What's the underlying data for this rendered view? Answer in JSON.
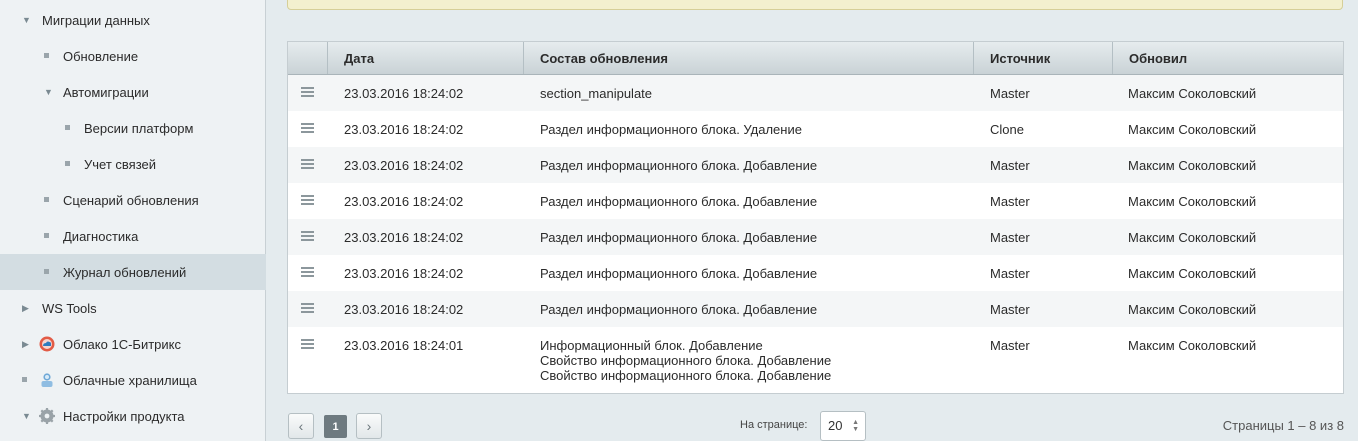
{
  "sidebar": {
    "items": [
      {
        "label": "Миграции данных",
        "expand": "down",
        "marker": "none"
      },
      {
        "label": "Обновление",
        "expand": "none",
        "marker": "bullet"
      },
      {
        "label": "Автомиграции",
        "expand": "down",
        "marker": "none"
      },
      {
        "label": "Версии платформ",
        "expand": "none",
        "marker": "bullet"
      },
      {
        "label": "Учет связей",
        "expand": "none",
        "marker": "bullet"
      },
      {
        "label": "Сценарий обновления",
        "expand": "none",
        "marker": "bullet"
      },
      {
        "label": "Диагностика",
        "expand": "none",
        "marker": "bullet"
      },
      {
        "label": "Журнал обновлений",
        "expand": "none",
        "marker": "bullet",
        "active": true
      },
      {
        "label": "WS Tools",
        "expand": "right",
        "marker": "none"
      },
      {
        "label": "Облако 1С-Битрикс",
        "expand": "right",
        "icon": "cloud-bitrix-icon"
      },
      {
        "label": "Облачные хранилища",
        "expand": "none",
        "marker": "bullet",
        "icon": "cloud-storage-icon"
      },
      {
        "label": "Настройки продукта",
        "expand": "down",
        "icon": "gear-icon"
      }
    ]
  },
  "table": {
    "headers": [
      "",
      "Дата",
      "Состав обновления",
      "Источник",
      "Обновил"
    ],
    "rows": [
      {
        "date": "23.03.2016 18:24:02",
        "content": [
          "section_manipulate"
        ],
        "source": "Master",
        "user": "Максим Соколовский"
      },
      {
        "date": "23.03.2016 18:24:02",
        "content": [
          "Раздел информационного блока. Удаление"
        ],
        "source": "Clone",
        "user": "Максим Соколовский"
      },
      {
        "date": "23.03.2016 18:24:02",
        "content": [
          "Раздел информационного блока. Добавление"
        ],
        "source": "Master",
        "user": "Максим Соколовский"
      },
      {
        "date": "23.03.2016 18:24:02",
        "content": [
          "Раздел информационного блока. Добавление"
        ],
        "source": "Master",
        "user": "Максим Соколовский"
      },
      {
        "date": "23.03.2016 18:24:02",
        "content": [
          "Раздел информационного блока. Добавление"
        ],
        "source": "Master",
        "user": "Максим Соколовский"
      },
      {
        "date": "23.03.2016 18:24:02",
        "content": [
          "Раздел информационного блока. Добавление"
        ],
        "source": "Master",
        "user": "Максим Соколовский"
      },
      {
        "date": "23.03.2016 18:24:02",
        "content": [
          "Раздел информационного блока. Добавление"
        ],
        "source": "Master",
        "user": "Максим Соколовский"
      },
      {
        "date": "23.03.2016 18:24:01",
        "content": [
          "Информационный блок. Добавление",
          "Свойство информационного блока. Добавление",
          "Свойство информационного блока. Добавление"
        ],
        "source": "Master",
        "user": "Максим Соколовский"
      }
    ]
  },
  "pagination": {
    "prev": "‹",
    "next": "›",
    "current_page": "1",
    "per_page_label": "На странице:",
    "per_page_value": "20",
    "summary": "Страницы 1 – 8 из 8"
  },
  "colors": {
    "active_item": "#d3dde2",
    "alt_row": "#f4f6f7",
    "notice": "#f3f0cf"
  }
}
